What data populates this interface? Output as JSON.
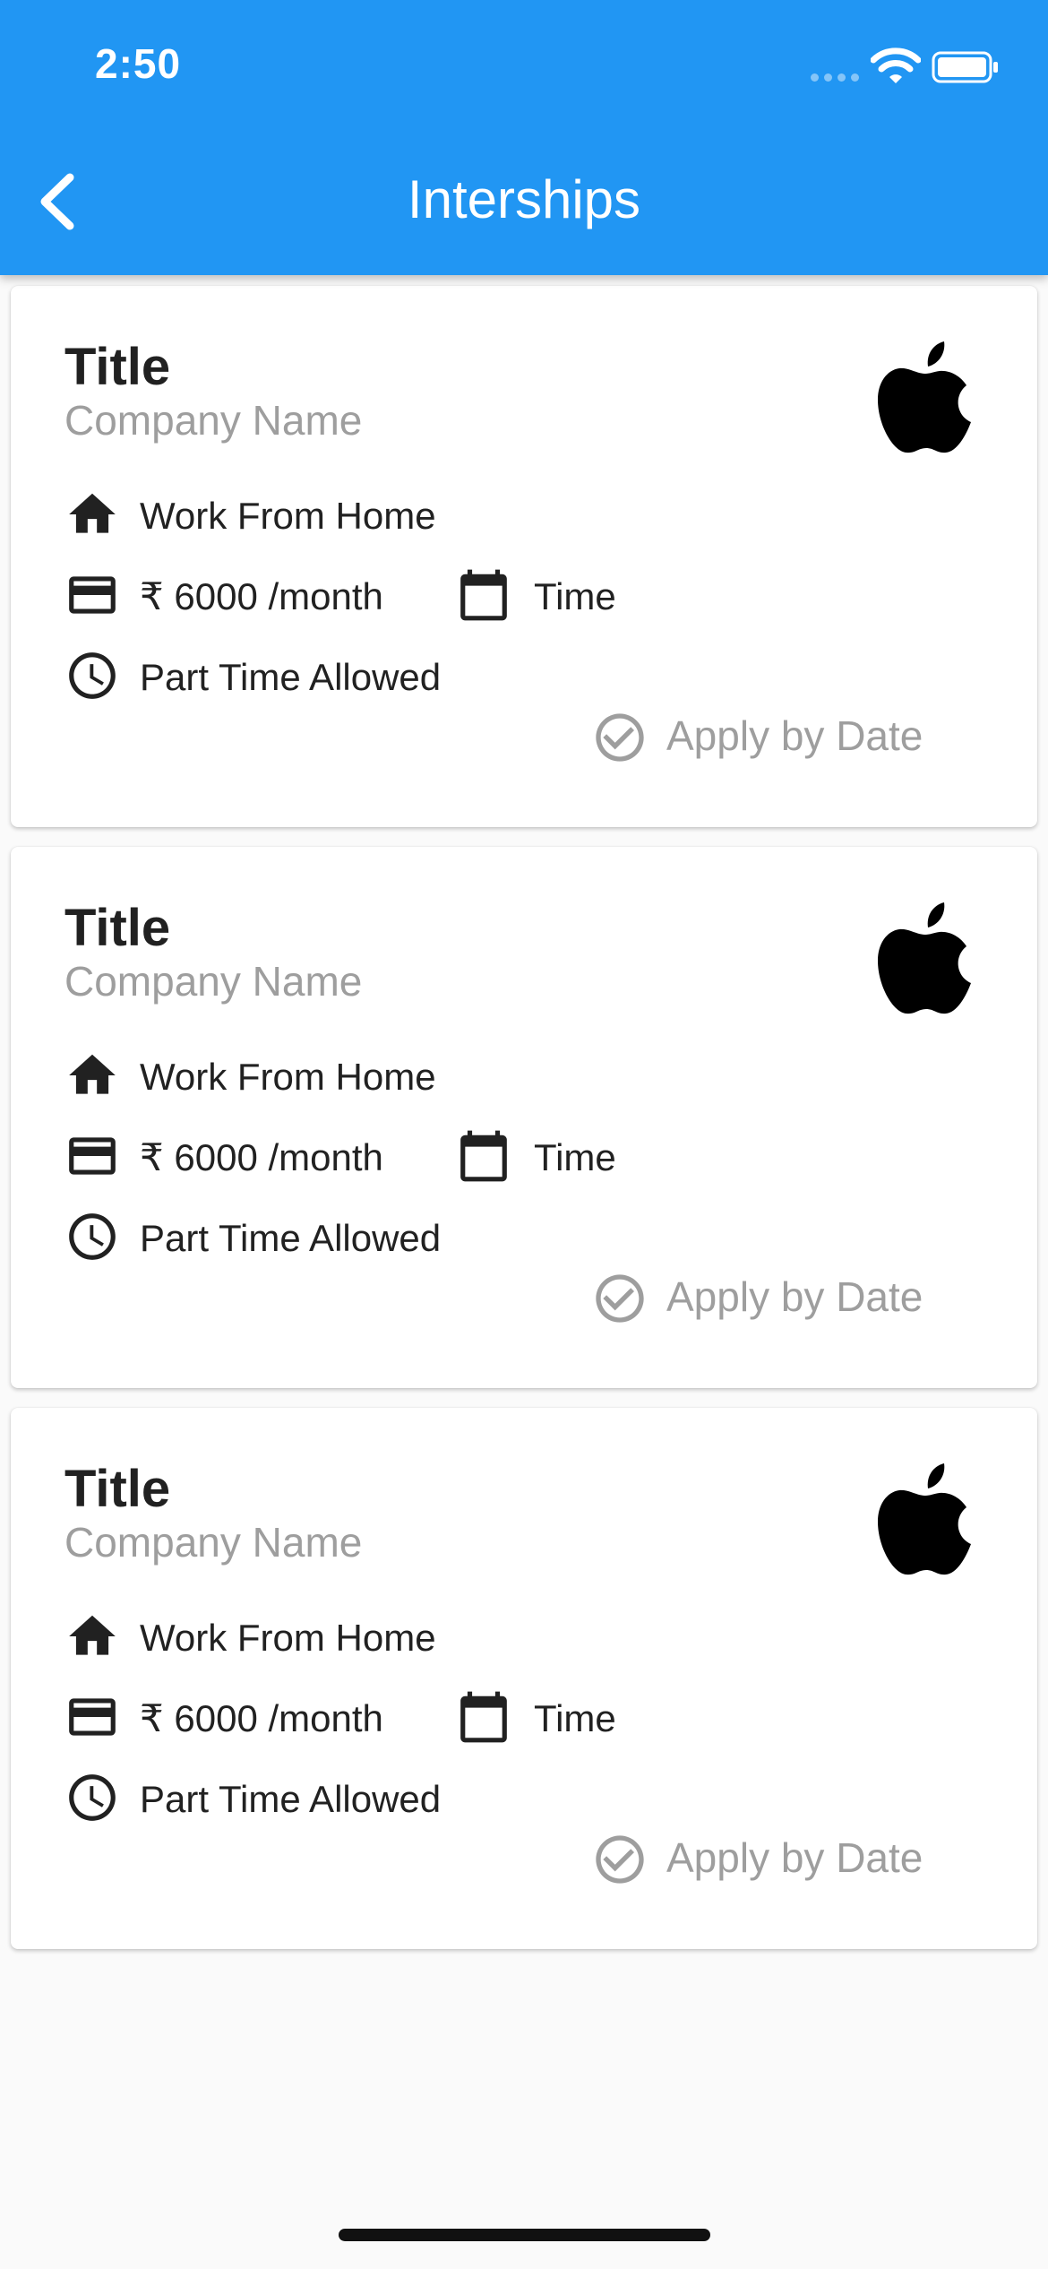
{
  "status_bar": {
    "time": "2:50"
  },
  "app_bar": {
    "title": "Interships"
  },
  "cards": [
    {
      "title": "Title",
      "company": "Company Name",
      "location": "Work From Home",
      "stipend": "₹ 6000 /month",
      "duration": "Time",
      "part_time": "Part Time Allowed",
      "apply_by": "Apply by Date",
      "logo": "apple-logo-icon"
    },
    {
      "title": "Title",
      "company": "Company Name",
      "location": "Work From Home",
      "stipend": "₹ 6000 /month",
      "duration": "Time",
      "part_time": "Part Time Allowed",
      "apply_by": "Apply by Date",
      "logo": "apple-logo-icon"
    },
    {
      "title": "Title",
      "company": "Company Name",
      "location": "Work From Home",
      "stipend": "₹ 6000 /month",
      "duration": "Time",
      "part_time": "Part Time Allowed",
      "apply_by": "Apply by Date",
      "logo": "apple-logo-icon"
    }
  ],
  "colors": {
    "primary": "#2196f3",
    "secondary_text": "#9e9e9e",
    "background": "#fafafa"
  }
}
